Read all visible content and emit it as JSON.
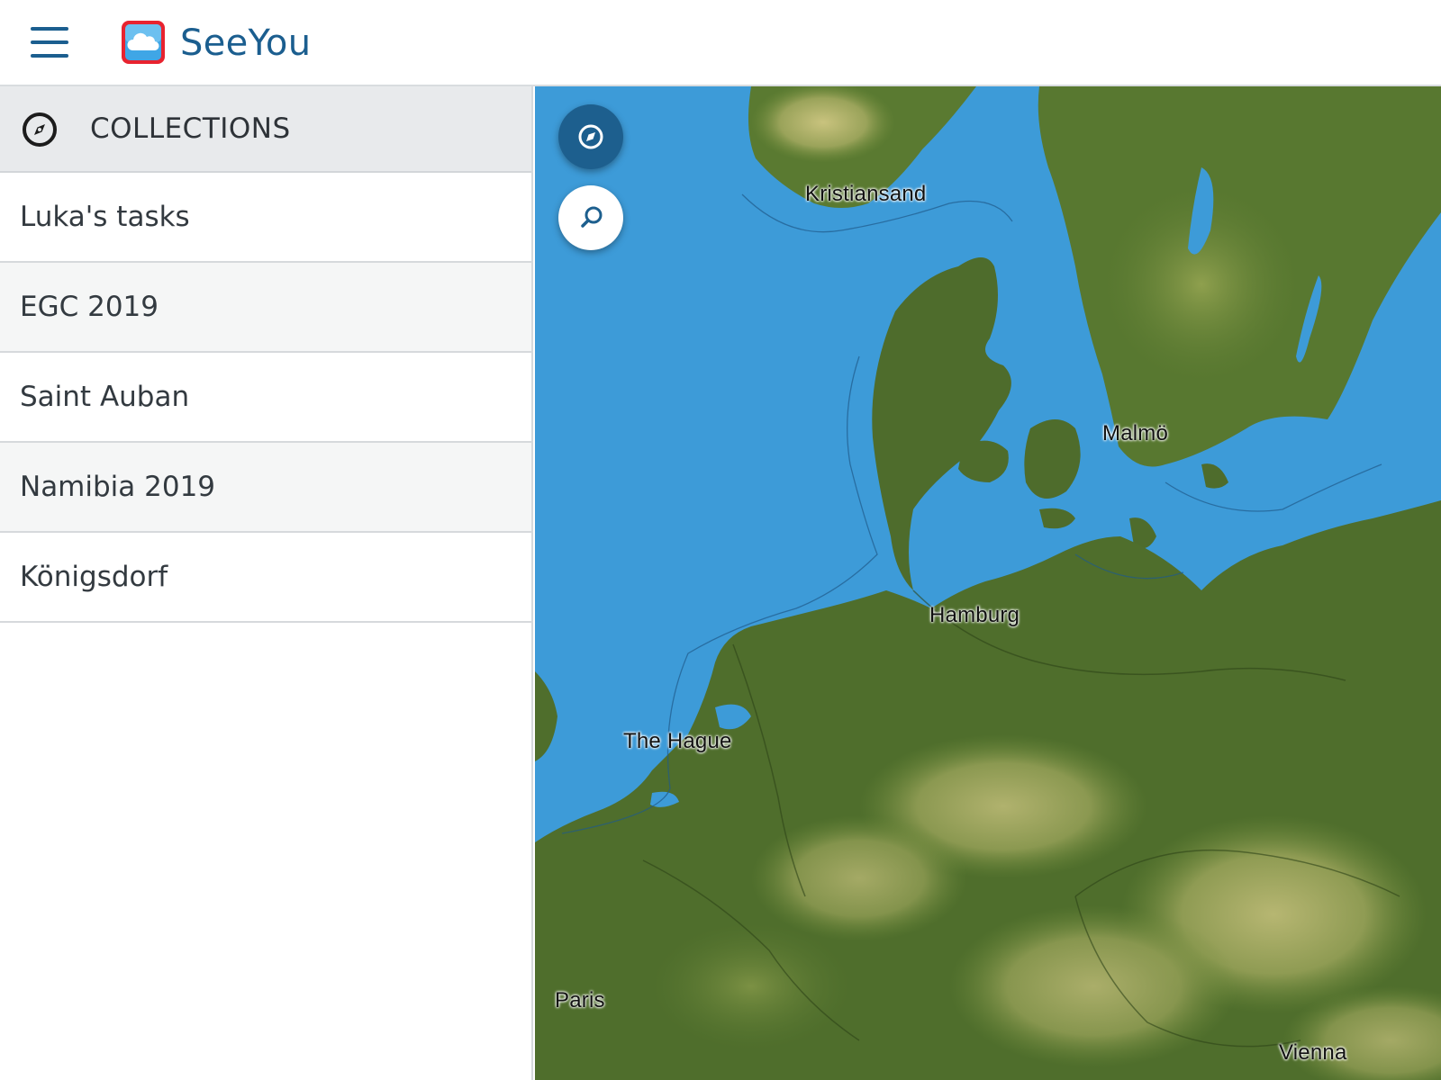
{
  "app": {
    "brand": "SeeYou",
    "accent_color": "#1b5e8f",
    "menu_icon": "hamburger-menu-icon",
    "logo_icon": "seeyou-cloud-logo"
  },
  "sidebar": {
    "header": {
      "title": "COLLECTIONS",
      "icon": "compass-icon"
    },
    "items": [
      {
        "label": "Luka's tasks"
      },
      {
        "label": "EGC 2019"
      },
      {
        "label": "Saint Auban"
      },
      {
        "label": "Namibia 2019"
      },
      {
        "label": "Königsdorf"
      }
    ]
  },
  "map": {
    "water_color": "#3d9bd8",
    "land_color": "#4f6e2c",
    "controls": [
      {
        "name": "compass-button",
        "icon": "compass-icon"
      },
      {
        "name": "search-button",
        "icon": "search-icon"
      }
    ],
    "cities": [
      "Kristiansand",
      "Malmö",
      "Hamburg",
      "The Hague",
      "Paris",
      "Vienna"
    ]
  }
}
